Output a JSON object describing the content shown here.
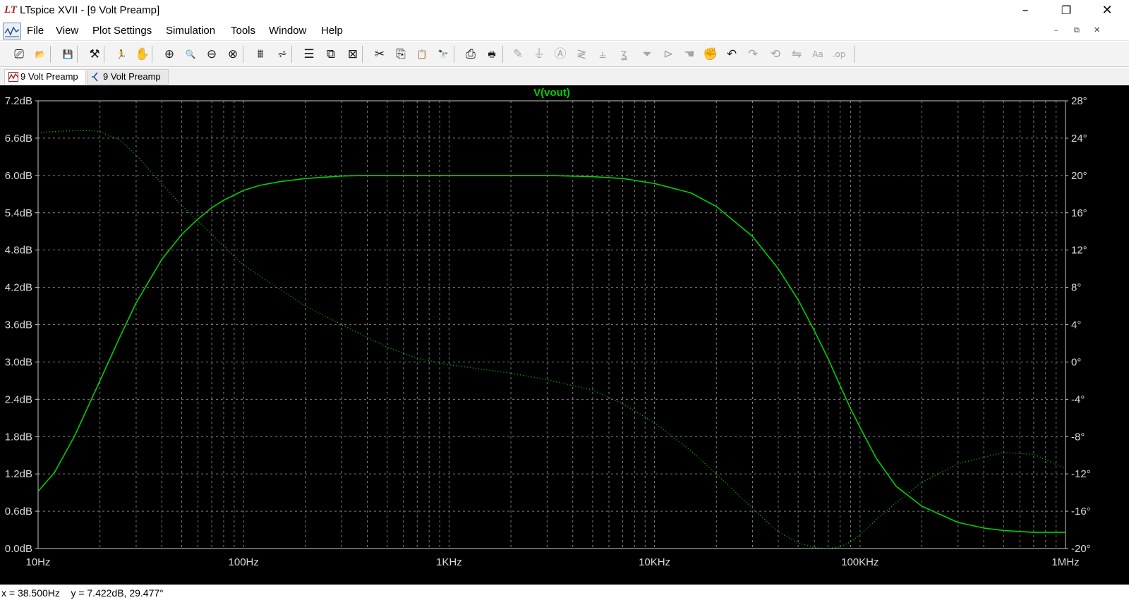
{
  "window": {
    "title": "LTspice XVII - [9 Volt Preamp]",
    "logo_text": "LT",
    "min_glyph": "–",
    "max_glyph": "❐",
    "close_glyph": "✕"
  },
  "menu": {
    "items": [
      "File",
      "View",
      "Plot Settings",
      "Simulation",
      "Tools",
      "Window",
      "Help"
    ],
    "mdi_min": "–",
    "mdi_restore": "⧉",
    "mdi_close": "✕"
  },
  "toolbar": {
    "buttons": [
      {
        "icon": "new-schematic-icon",
        "glyph": "⎚",
        "enabled": true
      },
      {
        "icon": "open-folder-icon",
        "glyph": "📂",
        "enabled": true
      },
      {
        "icon": "save-icon",
        "glyph": "💾",
        "enabled": true
      },
      {
        "icon": "control-panel-icon",
        "glyph": "⚒",
        "enabled": true
      },
      {
        "icon": "run-icon",
        "glyph": "🏃",
        "enabled": true
      },
      {
        "icon": "halt-hand-icon",
        "glyph": "✋",
        "enabled": true
      },
      {
        "icon": "zoom-area-icon",
        "glyph": "⊕",
        "enabled": true
      },
      {
        "icon": "zoom-in-icon",
        "glyph": "🔍",
        "enabled": true
      },
      {
        "icon": "zoom-out-icon",
        "glyph": "⊖",
        "enabled": true
      },
      {
        "icon": "zoom-fit-icon",
        "glyph": "⊗",
        "enabled": true
      },
      {
        "icon": "autorange-icon",
        "glyph": "⩩",
        "enabled": true
      },
      {
        "icon": "fft-icon",
        "glyph": "⩫",
        "enabled": true
      },
      {
        "icon": "tile-horizontal-icon",
        "glyph": "☰",
        "enabled": true
      },
      {
        "icon": "cascade-icon",
        "glyph": "⧉",
        "enabled": true
      },
      {
        "icon": "close-all-icon",
        "glyph": "⊠",
        "enabled": true
      },
      {
        "icon": "cut-icon",
        "glyph": "✂",
        "enabled": true
      },
      {
        "icon": "copy-icon",
        "glyph": "⎘",
        "enabled": true
      },
      {
        "icon": "paste-icon",
        "glyph": "📋",
        "enabled": true
      },
      {
        "icon": "find-icon",
        "glyph": "🔭",
        "enabled": true
      },
      {
        "icon": "print-icon",
        "glyph": "⎙",
        "enabled": true
      },
      {
        "icon": "print-setup-icon",
        "glyph": "🖶",
        "enabled": true
      },
      {
        "icon": "wire-icon",
        "glyph": "✎",
        "enabled": false
      },
      {
        "icon": "ground-icon",
        "glyph": "⏚",
        "enabled": false
      },
      {
        "icon": "label-net-icon",
        "glyph": "Ⓐ",
        "enabled": false
      },
      {
        "icon": "resistor-icon",
        "glyph": "≷",
        "enabled": false
      },
      {
        "icon": "capacitor-icon",
        "glyph": "⫨",
        "enabled": false
      },
      {
        "icon": "inductor-icon",
        "glyph": "ʓ",
        "enabled": false
      },
      {
        "icon": "diode-icon",
        "glyph": "⏷",
        "enabled": false
      },
      {
        "icon": "component-icon",
        "glyph": "⊳",
        "enabled": false
      },
      {
        "icon": "move-hand-icon",
        "glyph": "☚",
        "enabled": false
      },
      {
        "icon": "drag-hand-icon",
        "glyph": "✊",
        "enabled": false
      },
      {
        "icon": "undo-icon",
        "glyph": "↶",
        "enabled": true
      },
      {
        "icon": "redo-icon",
        "glyph": "↷",
        "enabled": false
      },
      {
        "icon": "rotate-icon",
        "glyph": "⟲",
        "enabled": false
      },
      {
        "icon": "mirror-icon",
        "glyph": "⇋",
        "enabled": false
      },
      {
        "icon": "text-icon",
        "glyph": "Aa",
        "enabled": false
      },
      {
        "icon": "spice-directive-icon",
        "glyph": ".op",
        "enabled": false
      }
    ]
  },
  "tabs": [
    {
      "label": "9 Volt Preamp",
      "icon": "waveform-icon",
      "active": true
    },
    {
      "label": "9 Volt Preamp",
      "icon": "schematic-icon",
      "active": false
    }
  ],
  "plot": {
    "background": "#000000",
    "grid_color": "#808080",
    "trace_color": "#00d000",
    "axis_text_color": "#d8d8d8"
  },
  "chart_data": {
    "type": "line",
    "title": "V(vout)",
    "x_scale": "log",
    "x_range": [
      10,
      1000000
    ],
    "x_ticks": [
      {
        "value": 10,
        "label": "10Hz"
      },
      {
        "value": 100,
        "label": "100Hz"
      },
      {
        "value": 1000,
        "label": "1KHz"
      },
      {
        "value": 10000,
        "label": "10KHz"
      },
      {
        "value": 100000,
        "label": "100KHz"
      },
      {
        "value": 1000000,
        "label": "1MHz"
      }
    ],
    "y_left_range": [
      0,
      7.2
    ],
    "y_left_ticks": [
      "7.2dB",
      "6.6dB",
      "6.0dB",
      "5.4dB",
      "4.8dB",
      "4.2dB",
      "3.6dB",
      "3.0dB",
      "2.4dB",
      "1.8dB",
      "1.2dB",
      "0.6dB",
      "0.0dB"
    ],
    "y_right_range": [
      -20,
      28
    ],
    "y_right_ticks": [
      "28°",
      "24°",
      "20°",
      "16°",
      "12°",
      "8°",
      "4°",
      "0°",
      "-4°",
      "-8°",
      "-12°",
      "-16°",
      "-20°"
    ],
    "grid": true,
    "series": [
      {
        "role": "magnitude",
        "axis": "left",
        "style": "solid",
        "x": [
          10,
          12,
          15,
          20,
          25,
          30,
          40,
          50,
          60,
          70,
          80,
          100,
          120,
          150,
          200,
          300,
          400,
          500,
          700,
          1000,
          2000,
          3000,
          5000,
          7000,
          10000,
          15000,
          20000,
          30000,
          40000,
          50000,
          60000,
          70000,
          80000,
          90000,
          100000,
          120000,
          150000,
          200000,
          300000,
          400000,
          500000,
          700000,
          1000000
        ],
        "values": [
          0.92,
          1.22,
          1.8,
          2.7,
          3.4,
          3.95,
          4.65,
          5.05,
          5.3,
          5.48,
          5.6,
          5.76,
          5.84,
          5.9,
          5.95,
          5.99,
          6.0,
          6.0,
          6.0,
          6.0,
          6.0,
          6.0,
          5.98,
          5.95,
          5.87,
          5.72,
          5.5,
          5.02,
          4.5,
          4.0,
          3.5,
          3.05,
          2.62,
          2.25,
          1.95,
          1.45,
          1.0,
          0.68,
          0.42,
          0.33,
          0.29,
          0.26,
          0.26
        ]
      },
      {
        "role": "phase",
        "axis": "right",
        "style": "dotted",
        "x": [
          10,
          12,
          15,
          18,
          20,
          25,
          30,
          40,
          50,
          60,
          70,
          80,
          100,
          150,
          200,
          300,
          500,
          700,
          1000,
          2000,
          3000,
          5000,
          7000,
          10000,
          15000,
          20000,
          30000,
          40000,
          50000,
          60000,
          70000,
          80000,
          90000,
          100000,
          120000,
          150000,
          200000,
          300000,
          500000,
          700000,
          1000000
        ],
        "values": [
          24.6,
          24.7,
          24.8,
          24.8,
          24.7,
          23.8,
          22.2,
          19.1,
          16.8,
          15.1,
          13.7,
          12.4,
          10.4,
          7.8,
          6.0,
          4.0,
          1.6,
          0.4,
          -0.3,
          -1.2,
          -1.9,
          -3.0,
          -4.5,
          -6.5,
          -9.5,
          -12.0,
          -15.7,
          -18.2,
          -19.4,
          -19.9,
          -20.0,
          -19.8,
          -19.3,
          -18.5,
          -16.9,
          -15.1,
          -12.9,
          -10.9,
          -9.7,
          -9.9,
          -11.4
        ]
      }
    ]
  },
  "status": {
    "text": "x = 38.500Hz    y = 7.422dB, 29.477°"
  }
}
